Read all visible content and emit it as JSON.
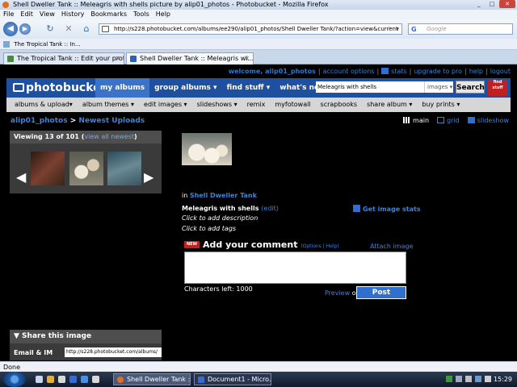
{
  "browser": {
    "window_title": "Shell Dweller Tank :: Meleagris with shells picture by alip01_photos - Photobucket - Mozilla Firefox",
    "menu": [
      "File",
      "Edit",
      "View",
      "History",
      "Bookmarks",
      "Tools",
      "Help"
    ],
    "url": "http://s228.photobucket.com/albums/ee290/alip01_photos/Shell Dweller Tank/?action=view&current",
    "search_placeholder": "Google",
    "bookmark": "The Tropical Tank :: In...",
    "tabs": [
      {
        "label": "The Tropical Tank :: Edit your profile"
      },
      {
        "label": "Shell Dweller Tank :: Meleagris wi..."
      }
    ],
    "status": "Done"
  },
  "pb": {
    "top_links": {
      "welcome": "welcome, alip01_photos",
      "account": "account options",
      "stats": "stats",
      "upgrade": "upgrade to pro",
      "help": "help",
      "logout": "logout"
    },
    "logo": "photobucket",
    "nav": [
      "my albums",
      "group albums ▾",
      "find stuff ▾",
      "what's new ▾"
    ],
    "search_value": "Meleagris with shells",
    "search_scope": "images ▾",
    "search_button": "Search",
    "badge": "find stuff",
    "subnav": [
      "albums & upload▾",
      "album themes ▾",
      "edit images ▾",
      "slideshows ▾",
      "remix",
      "myfotowall",
      "scrapbooks",
      "share album ▾",
      "buy prints ▾"
    ],
    "breadcrumb": {
      "user": "alip01_photos",
      "sep": ">",
      "page": "Newest Uploads"
    },
    "views": [
      "main",
      "grid",
      "slideshow"
    ],
    "viewer": {
      "heading": "Viewing 13 of 101",
      "link": "view all newest"
    },
    "album_prefix": "in",
    "album_name": "Shell Dweller Tank",
    "image_title": "Meleagris with shells",
    "edit": "(edit)",
    "add_description": "Click to add description",
    "add_tags": "Click to add tags",
    "stats_link": "Get image stats",
    "comment": {
      "new_badge": "NEW",
      "heading": "Add your comment",
      "options": "(Options | Help)",
      "attach": "Attach image",
      "chars_left": "Characters left: 1000",
      "preview": "Preview",
      "or": "or",
      "post": "Post"
    },
    "share": {
      "heading": "▼ Share this image",
      "label": "Email & IM",
      "value": "http://s228.photobucket.com/albums/"
    }
  },
  "taskbar": {
    "tasks": [
      "Shell Dweller Tank ::...",
      "Document1 - Micro..."
    ],
    "clock": "15:29"
  }
}
